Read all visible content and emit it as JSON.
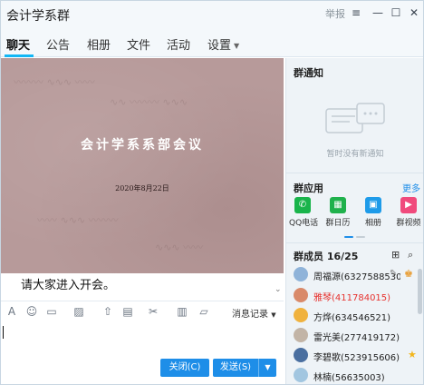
{
  "window": {
    "title": "会计学系群",
    "report_label": "举报"
  },
  "tabs": [
    {
      "label": "聊天",
      "active": true
    },
    {
      "label": "公告"
    },
    {
      "label": "相册"
    },
    {
      "label": "文件"
    },
    {
      "label": "活动"
    },
    {
      "label": "设置"
    }
  ],
  "banner": {
    "title": "会计学系系部会议",
    "date": "2020年8月22日"
  },
  "chat": {
    "message": "请大家进入开会。"
  },
  "toolbar": {
    "history_label": "消息记录"
  },
  "buttons": {
    "close": "关闭(C)",
    "send": "发送(S)"
  },
  "right_panel": {
    "notice_title": "群通知",
    "notice_empty": "暂时没有新通知",
    "apps_title": "群应用",
    "apps_more": "更多",
    "apps": [
      {
        "label": "QQ电话",
        "color": "#19b44b",
        "icon": "phone-icon",
        "glyph": "✆"
      },
      {
        "label": "群日历",
        "color": "#1fb14c",
        "icon": "calendar-icon",
        "glyph": "▦"
      },
      {
        "label": "相册",
        "color": "#1e9be9",
        "icon": "photo-icon",
        "glyph": "▣"
      },
      {
        "label": "群视频",
        "color": "#f04a7c",
        "icon": "video-icon",
        "glyph": "▶"
      }
    ],
    "members_title": "群成员 16/25",
    "members": [
      {
        "name": "周福源(6327588530",
        "red": false,
        "avatar": "#8fb3d9"
      },
      {
        "name": "雅琴(411784015)",
        "red": true,
        "avatar": "#d98a6a"
      },
      {
        "name": "方烨(634546521)",
        "red": false,
        "avatar": "#f0b23e"
      },
      {
        "name": "雷光美(277419172)",
        "red": false,
        "avatar": "#c2b4a6"
      },
      {
        "name": "李碧歌(523915606)",
        "red": false,
        "avatar": "#4a6fa0"
      },
      {
        "name": "林楠(56635003)",
        "red": false,
        "avatar": "#a2c6e0"
      }
    ]
  }
}
